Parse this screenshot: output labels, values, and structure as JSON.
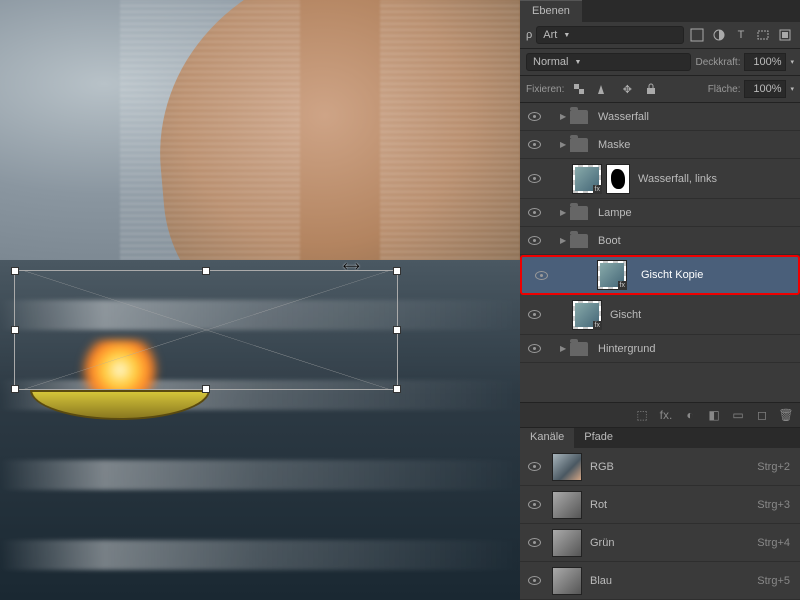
{
  "panel": {
    "tab": "Ebenen"
  },
  "filter": {
    "label": "Art",
    "glyph": "ρ"
  },
  "blend": {
    "mode": "Normal"
  },
  "opacity": {
    "label": "Deckkraft:",
    "value": "100%"
  },
  "lock": {
    "label": "Fixieren:"
  },
  "fill": {
    "label": "Fläche:",
    "value": "100%"
  },
  "layers": [
    {
      "type": "group",
      "name": "Wasserfall",
      "indent": 1
    },
    {
      "type": "group",
      "name": "Maske",
      "indent": 1
    },
    {
      "type": "layer",
      "name": "Wasserfall, links",
      "indent": 1,
      "tall": true,
      "mask": true
    },
    {
      "type": "group",
      "name": "Lampe",
      "indent": 1
    },
    {
      "type": "group",
      "name": "Boot",
      "indent": 1
    },
    {
      "type": "layer",
      "name": "Gischt Kopie",
      "indent": 1,
      "tall": true,
      "selected": true,
      "highlight": true
    },
    {
      "type": "layer",
      "name": "Gischt",
      "indent": 1,
      "tall": true
    },
    {
      "type": "group",
      "name": "Hintergrund",
      "indent": 1
    }
  ],
  "channelsPanel": {
    "tabs": [
      "Kanäle",
      "Pfade"
    ],
    "rows": [
      {
        "name": "RGB",
        "key": "Strg+2",
        "rgb": true
      },
      {
        "name": "Rot",
        "key": "Strg+3"
      },
      {
        "name": "Grün",
        "key": "Strg+4"
      },
      {
        "name": "Blau",
        "key": "Strg+5"
      }
    ]
  },
  "bottomIcons": [
    "⬚",
    "fx.",
    "◐",
    "◧",
    "▭",
    "◻",
    "🗑"
  ]
}
